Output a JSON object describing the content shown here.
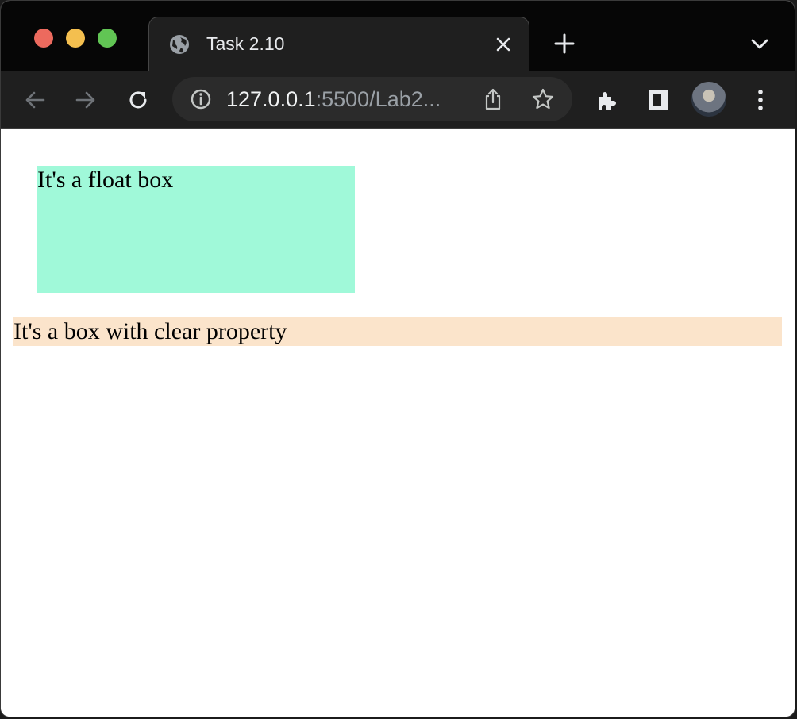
{
  "window": {
    "traffic_lights": {
      "close": "#ec6a5e",
      "minimize": "#f4bf4f",
      "maximize": "#61c554"
    }
  },
  "tabs": [
    {
      "title": "Task 2.10",
      "favicon": "globe-icon",
      "active": true
    }
  ],
  "toolbar": {
    "back": "arrow-left-icon",
    "forward": "arrow-right-icon",
    "reload": "reload-icon",
    "address": {
      "host": "127.0.0.1",
      "rest": ":5500/Lab2..."
    },
    "icons": [
      "info-icon",
      "share-icon",
      "star-icon",
      "extensions-icon",
      "side-panel-icon",
      "menu-kebab-icon"
    ]
  },
  "page": {
    "float_box": {
      "text": "It's a float box",
      "background": "#a0f9d9"
    },
    "clear_box": {
      "text": "It's a box with clear property",
      "background": "#fbe4cb"
    }
  }
}
